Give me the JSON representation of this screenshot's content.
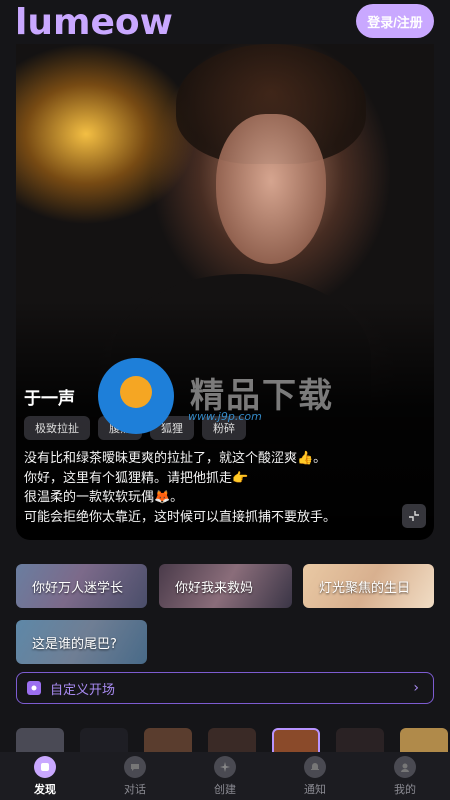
{
  "header": {
    "logo": "lumeow",
    "login_label": "登录/注册"
  },
  "hero": {
    "name": "于一声",
    "tags": [
      "极致拉扯",
      "腹黑",
      "狐狸",
      "粉碎"
    ],
    "description": "没有比和绿茶暧昧更爽的拉扯了，就这个酸涩爽👍。\n你好，这里有个狐狸精。请把他抓走👉\n很温柔的一款软软玩偶🦊。\n可能会拒绝你太靠近，这时候可以直接抓捕不要放手。"
  },
  "watermark": {
    "text": "精品下载",
    "url": "www.j9p.com"
  },
  "openers": [
    "你好万人迷学长",
    "你好我来救妈",
    "灯光聚焦的生日",
    "这是谁的尾巴?"
  ],
  "custom_opener": {
    "label": "自定义开场"
  },
  "strip_colors": [
    "#4a4a55",
    "#1e1e24",
    "#5a3d2e",
    "#3a2a26",
    "#8a4a2a",
    "#2a2224",
    "#b08a4a"
  ],
  "nav": {
    "items": [
      {
        "label": "发现",
        "icon": "discover-icon",
        "active": true
      },
      {
        "label": "对话",
        "icon": "chat-icon",
        "active": false
      },
      {
        "label": "创建",
        "icon": "create-icon",
        "active": false
      },
      {
        "label": "通知",
        "icon": "bell-icon",
        "active": false
      },
      {
        "label": "我的",
        "icon": "profile-icon",
        "active": false
      }
    ]
  },
  "colors": {
    "accent": "#c9a8ff",
    "background": "#151518",
    "custom_border": "#7d5cd1"
  }
}
